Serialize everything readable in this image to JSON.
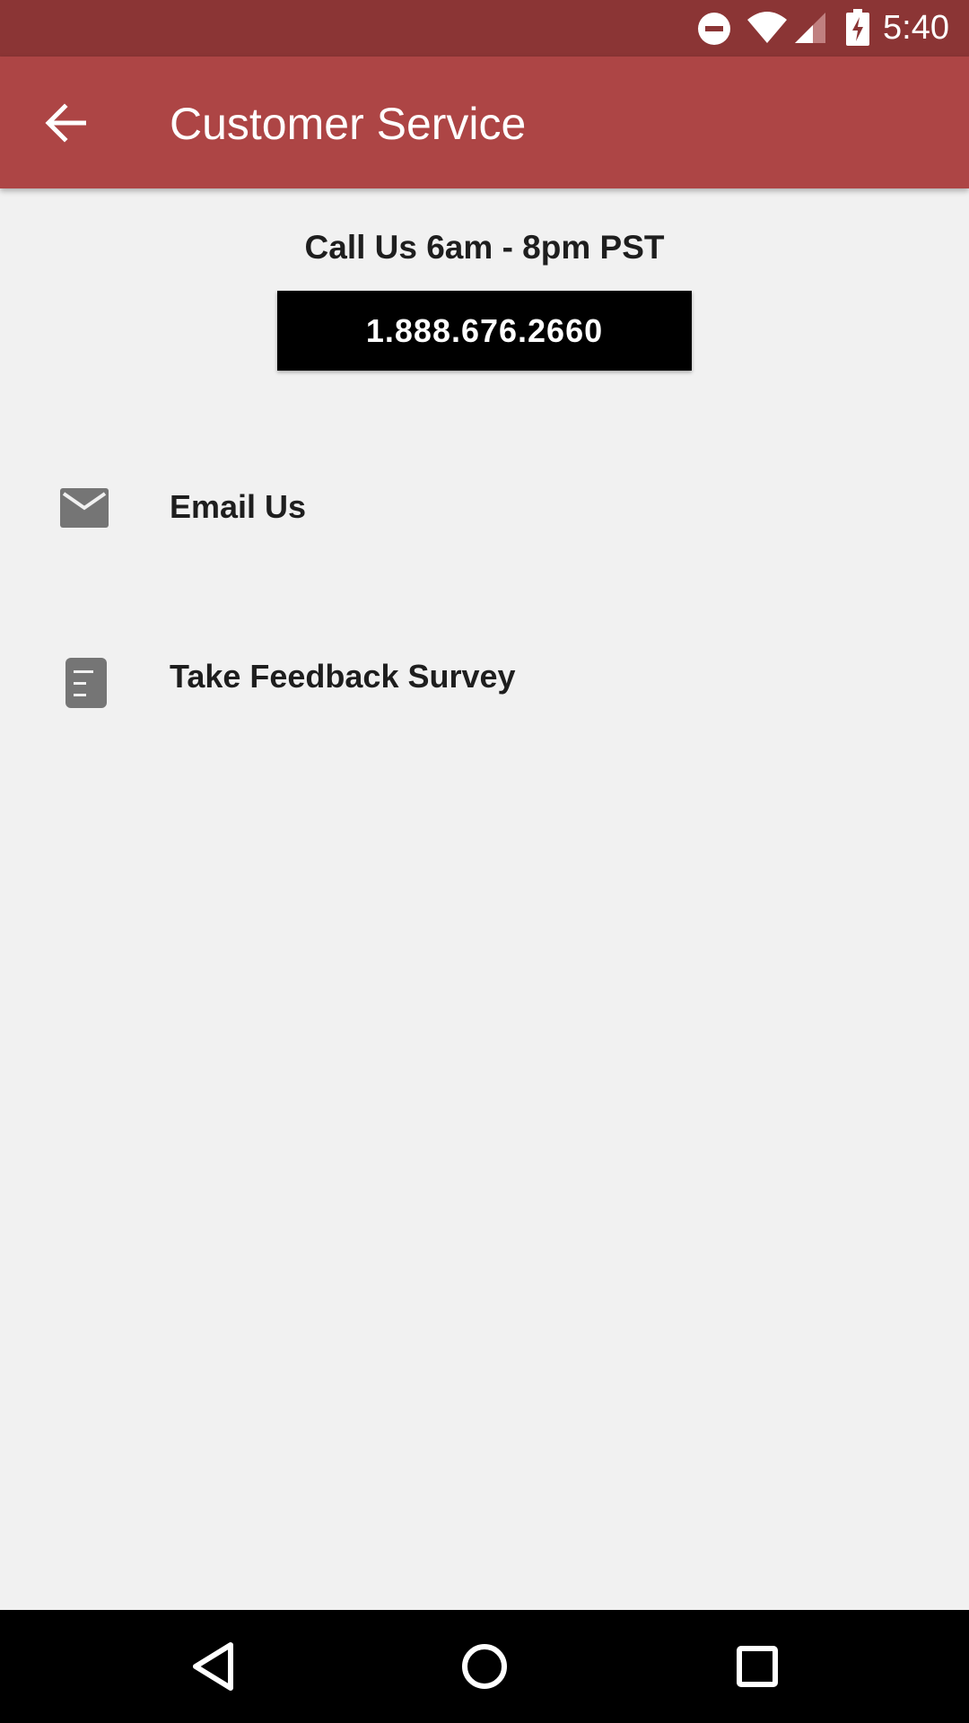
{
  "status_bar": {
    "time": "5:40",
    "icons": [
      "do-not-disturb-icon",
      "wifi-icon",
      "cell-signal-icon",
      "battery-charging-icon"
    ]
  },
  "app_bar": {
    "title": "Customer Service",
    "back_icon": "arrow-back-icon",
    "color": "#ad4545"
  },
  "call": {
    "label": "Call Us 6am - 8pm PST",
    "phone": "1.888.676.2660"
  },
  "items": [
    {
      "label": "Email Us",
      "icon": "envelope-icon"
    },
    {
      "label": "Take Feedback Survey",
      "icon": "document-icon"
    }
  ],
  "nav_bar": {
    "buttons": [
      "back-triangle-icon",
      "home-circle-icon",
      "recents-square-icon"
    ]
  },
  "colors": {
    "status_bar": "#8b3535",
    "app_bar": "#ad4545",
    "background": "#f1f1f1",
    "icon_gray": "#757575"
  }
}
